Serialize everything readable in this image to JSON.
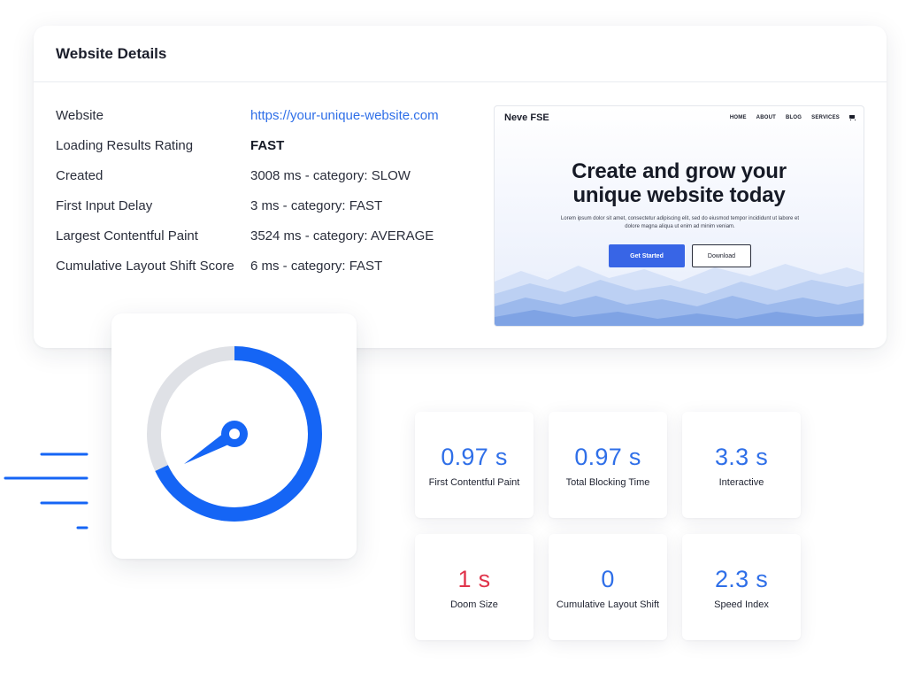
{
  "details": {
    "title": "Website Details",
    "rows": [
      {
        "label": "Website",
        "value": "https://your-unique-website.com"
      },
      {
        "label": "Loading Results Rating",
        "value": "FAST"
      },
      {
        "label": "Created",
        "value": "3008 ms - category: SLOW"
      },
      {
        "label": "First Input Delay",
        "value": "3 ms - category: FAST"
      },
      {
        "label": "Largest Contentful Paint",
        "value": "3524 ms - category: AVERAGE"
      },
      {
        "label": "Cumulative Layout Shift Score",
        "value": "6 ms - category: FAST"
      }
    ]
  },
  "preview": {
    "brand": "Neve FSE",
    "menu": [
      "HOME",
      "ABOUT",
      "BLOG",
      "SERVICES"
    ],
    "cart_icon": "cart-icon",
    "headline_line1": "Create and grow your",
    "headline_line2": "unique website today",
    "subtext": "Lorem ipsum dolor sit amet, consectetur adipiscing elit, sed do eiusmod tempor incididunt ut labore et dolore magna aliqua ut enim ad minim veniam.",
    "primary_button": "Get Started",
    "secondary_button": "Download"
  },
  "gauge": {
    "icon": "speedometer-icon",
    "level_percent": 68,
    "track_color": "#dfe1e6",
    "fill_color": "#1565f5"
  },
  "metrics": [
    {
      "value": "0.97 s",
      "label": "First Contentful Paint",
      "status": "good"
    },
    {
      "value": "0.97 s",
      "label": "Total Blocking Time",
      "status": "good"
    },
    {
      "value": "3.3 s",
      "label": "Interactive",
      "status": "good"
    },
    {
      "value": "1 s",
      "label": "Doom Size",
      "status": "bad"
    },
    {
      "value": "0",
      "label": "Cumulative Layout Shift",
      "status": "good"
    },
    {
      "value": "2.3 s",
      "label": "Speed Index",
      "status": "good"
    }
  ],
  "colors": {
    "accent": "#2f6fe8",
    "bad": "#e0344b",
    "gauge": "#1565f5"
  }
}
